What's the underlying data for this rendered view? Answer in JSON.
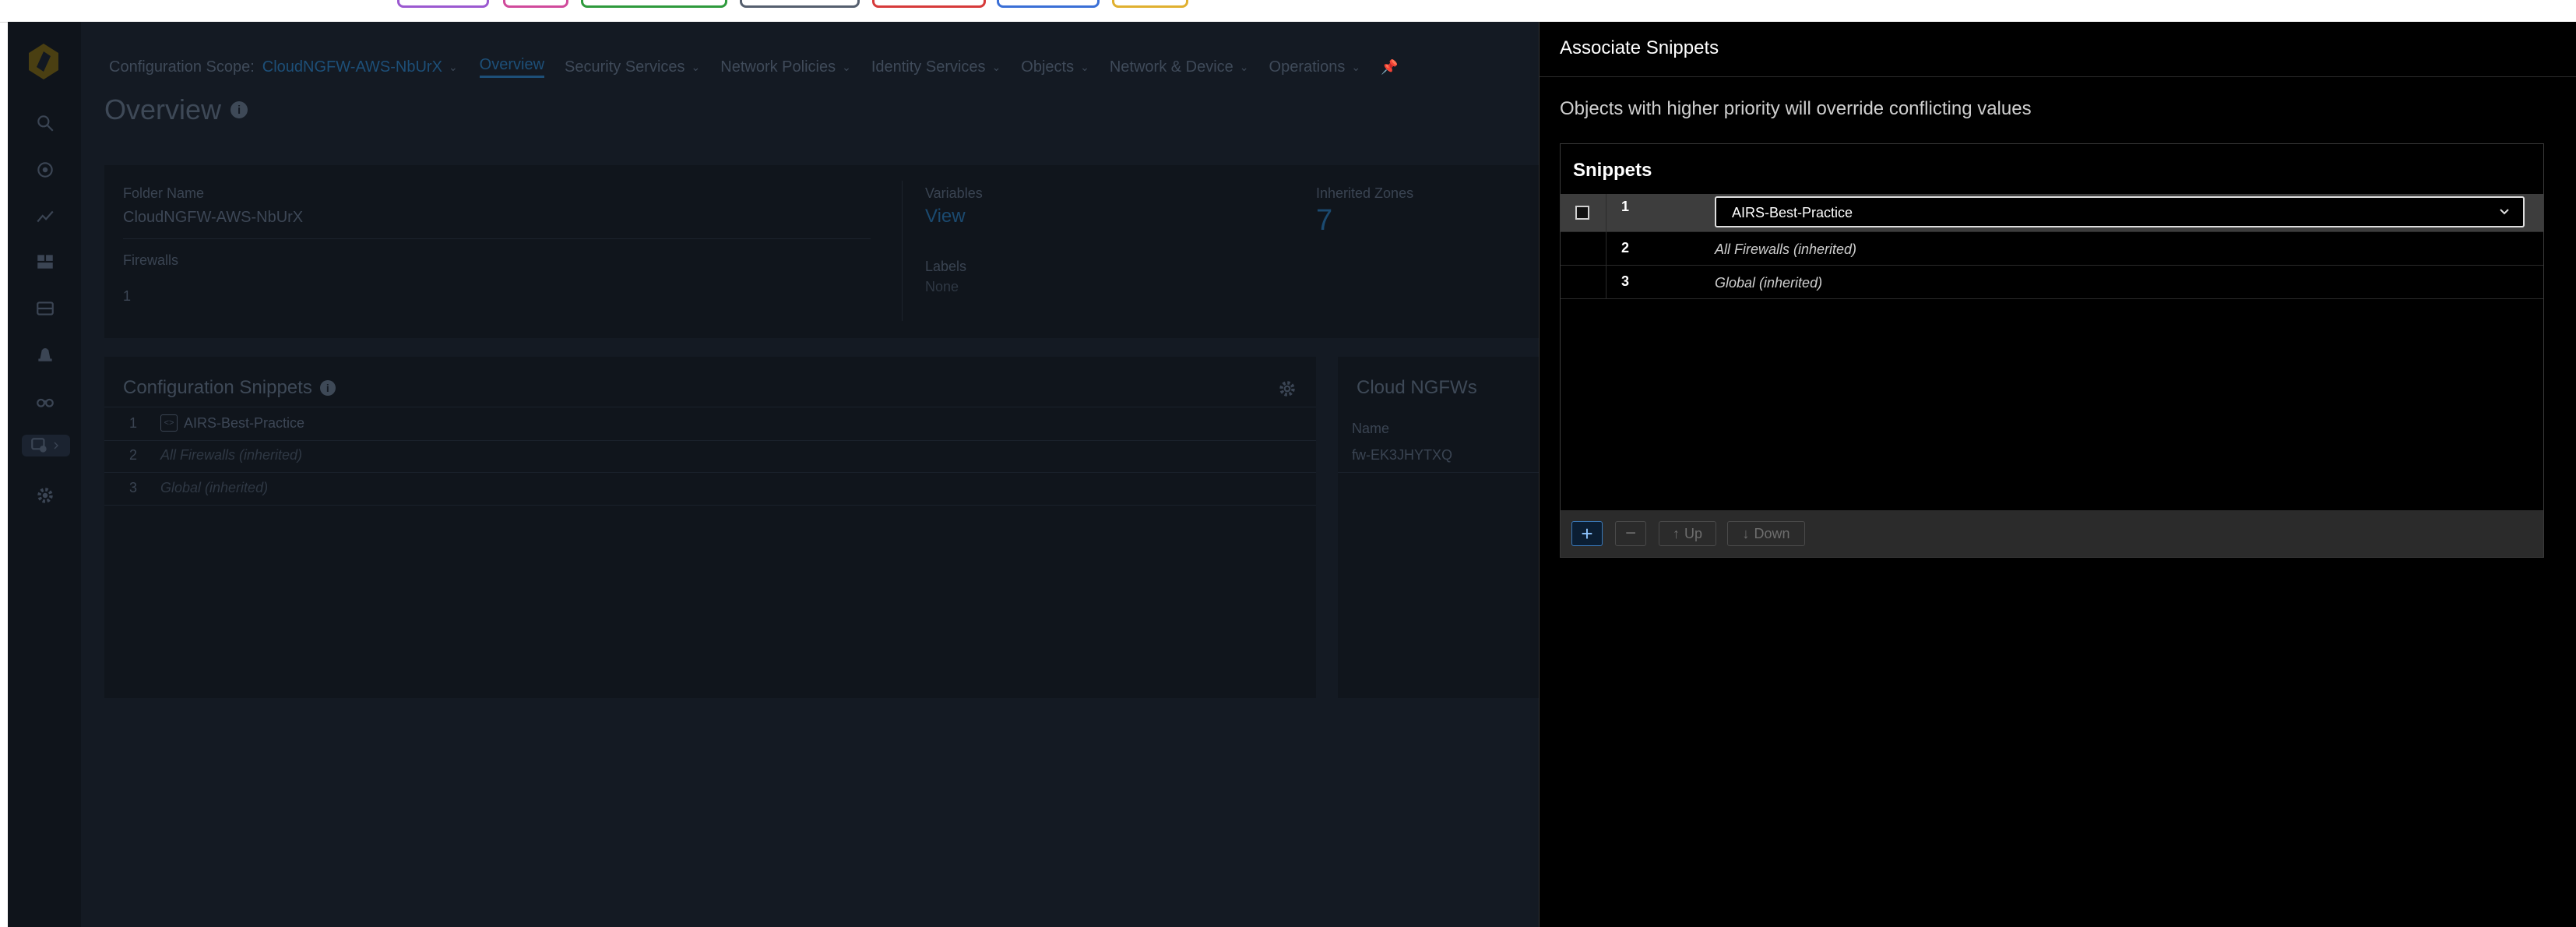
{
  "background": {
    "top_nav": {
      "scope_label": "Configuration Scope:",
      "scope_value": "CloudNGFW-AWS-NbUrX",
      "items": [
        {
          "label": "Overview"
        },
        {
          "label": "Security Services"
        },
        {
          "label": "Network Policies"
        },
        {
          "label": "Identity Services"
        },
        {
          "label": "Objects"
        },
        {
          "label": "Network & Device"
        },
        {
          "label": "Operations"
        }
      ]
    },
    "page_title": "Overview",
    "folder": {
      "name_label": "Folder Name",
      "name_value": "CloudNGFW-AWS-NbUrX",
      "firewalls_label": "Firewalls",
      "firewalls_value": "1",
      "variables_label": "Variables",
      "variables_value": "View",
      "labels_label": "Labels",
      "labels_value": "None",
      "zones_label": "Inherited Zones",
      "zones_value": "7"
    },
    "config_snippets": {
      "title": "Configuration Snippets",
      "rows": [
        {
          "num": "1",
          "name": "AIRS-Best-Practice"
        },
        {
          "num": "2",
          "name": "All Firewalls (inherited)"
        },
        {
          "num": "3",
          "name": "Global (inherited)"
        }
      ]
    },
    "cloud_ngfws": {
      "title": "Cloud NGFWs",
      "col_name": "Name",
      "row_value": "fw-EK3JHYTXQ"
    }
  },
  "drawer": {
    "title": "Associate Snippets",
    "description": "Objects with higher priority will override conflicting values",
    "panel_title": "Snippets",
    "rows": [
      {
        "num": "1",
        "name": "AIRS-Best-Practice"
      },
      {
        "num": "2",
        "name": "All Firewalls (inherited)"
      },
      {
        "num": "3",
        "name": "Global (inherited)"
      }
    ],
    "footer": {
      "add": "+",
      "remove": "−",
      "up": "Up",
      "down": "Down"
    }
  },
  "colors": {
    "accent": "#3a78b8",
    "drawer_bg": "#000000",
    "app_bg": "#141a23"
  }
}
